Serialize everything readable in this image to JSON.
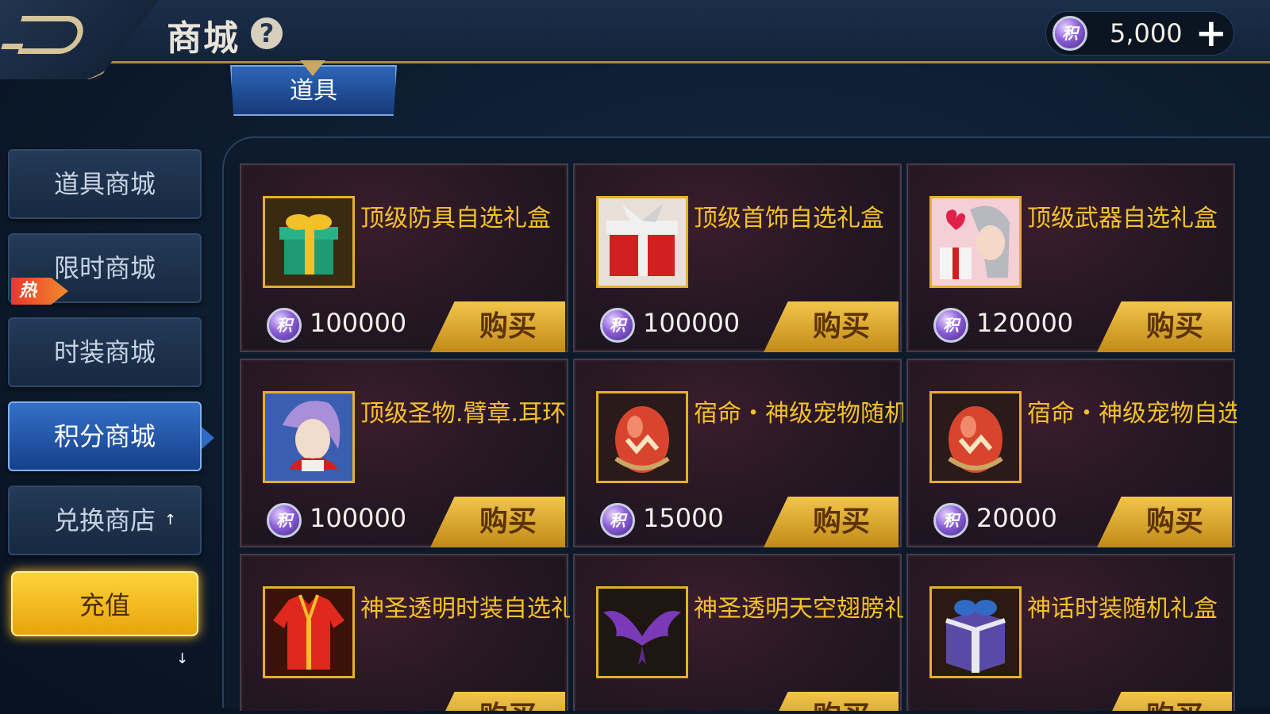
{
  "header": {
    "title": "商城",
    "help_icon": "?",
    "currency": {
      "icon": "积",
      "amount": "5,000",
      "plus": "+"
    }
  },
  "tabs": [
    {
      "label": "道具"
    }
  ],
  "sidebar": {
    "items": [
      {
        "label": "道具商城"
      },
      {
        "label": "限时商城",
        "badge": "热"
      },
      {
        "label": "时装商城"
      },
      {
        "label": "积分商城",
        "active": true
      },
      {
        "label": "兑换商店",
        "arrow": "↑"
      }
    ],
    "recharge": "充值",
    "down_arrow": "↓"
  },
  "content": {
    "right_arrow": "→",
    "coin_icon": "积",
    "buy_label": "购买"
  },
  "products": [
    {
      "name": "顶级防具自选礼盒",
      "price": "100000",
      "icon": "gift-box-icon"
    },
    {
      "name": "顶级首饰自选礼盒",
      "price": "100000",
      "icon": "red-gift-box-icon"
    },
    {
      "name": "顶级武器自选礼盒",
      "price": "120000",
      "icon": "character-portrait-icon"
    },
    {
      "name": "顶级圣物.臂章.耳环自",
      "price": "100000",
      "icon": "purple-hair-character-icon"
    },
    {
      "name": "宿命・神级宠物随机",
      "price": "15000",
      "icon": "pet-egg-icon"
    },
    {
      "name": "宿命・神级宠物自选",
      "price": "20000",
      "icon": "pet-egg-icon"
    },
    {
      "name": "神圣透明时装自选礼盒",
      "price": "",
      "icon": "red-robe-icon"
    },
    {
      "name": "神圣透明天空翅膀礼",
      "price": "",
      "icon": "purple-wings-icon"
    },
    {
      "name": "神话时装随机礼盒",
      "price": "",
      "icon": "blue-gift-box-icon"
    }
  ],
  "colors": {
    "accent_gold": "#f4c12a",
    "active_blue": "#2f6ac4",
    "hot_red": "#e8392a"
  }
}
